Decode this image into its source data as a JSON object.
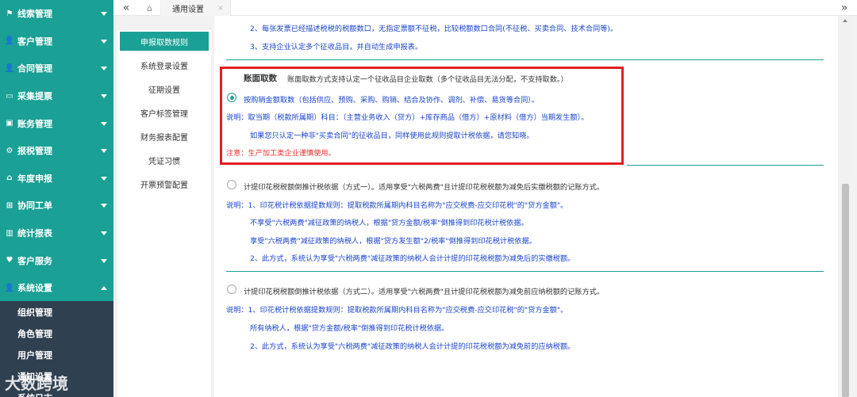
{
  "sidebar": {
    "items": [
      {
        "label": "线索管理",
        "icon": "flag-icon",
        "glyph": "⚑"
      },
      {
        "label": "客户管理",
        "icon": "user-icon",
        "glyph": "👤"
      },
      {
        "label": "合同管理",
        "icon": "user-icon",
        "glyph": "👤"
      },
      {
        "label": "采集提票",
        "icon": "inbox-icon",
        "glyph": "▭"
      },
      {
        "label": "账务管理",
        "icon": "monitor-icon",
        "glyph": "▣"
      },
      {
        "label": "报税管理",
        "icon": "gears-icon",
        "glyph": "⚙"
      },
      {
        "label": "年度申报",
        "icon": "home-icon",
        "glyph": "⌂"
      },
      {
        "label": "协同工单",
        "icon": "sitemap-icon",
        "glyph": "⊞"
      },
      {
        "label": "统计报表",
        "icon": "chart-icon",
        "glyph": "▥"
      },
      {
        "label": "客户服务",
        "icon": "heart-icon",
        "glyph": "♥"
      },
      {
        "label": "系统设置",
        "icon": "user-icon",
        "glyph": "👤"
      }
    ],
    "submenu": [
      "组织管理",
      "角色管理",
      "用户管理",
      "通知设置",
      "系统日志"
    ]
  },
  "tabbar": {
    "collapse_glyph": "«",
    "home_glyph": "⌂",
    "active_tab": "通用设置",
    "close_glyph": "×",
    "expand_glyph": "»"
  },
  "secondary_menu": [
    "申报取数规则",
    "系统登录设置",
    "征期设置",
    "客户标签管理",
    "财务报表配置",
    "凭证习惯",
    "开票预警配置"
  ],
  "content": {
    "top_line1": "2、每张发票已经描述税税的税额数口，无指定票额不征税，比较税额数口合同(不征税、买卖合同、技术合同等)。",
    "top_line2": "3、支持企业认定多个征收品目，并自动生成申报表。",
    "box_title": "账面取数",
    "box_subtitle": "账面取数方式支持认定一个征收品目企业取数（多个征收品目无法分配，不支持取数。）",
    "box_option": "按购销金额取数（包括供应、预购、采购、购销、结合及协作、调剂、补偿、易货等合同）。",
    "box_desc1": "说明：取当期（税款所属期）科目：（主营业务收入（贷方）+库存商品（借方）+原材料（借方）当期发生额）。",
    "box_desc2": "如果您只认定一种非\"买卖合同\"的征收品目，同样使用此规则提取计税依据，请您知晓。",
    "box_note": "注意：生产加工类企业谨慎使用。",
    "m1_option": "计提印花税税额倒推计税依据（方式一）。适用享受\"六税两费\"且计提印花税税额为减免后实缴税额的记账方式。",
    "m1_desc1": "说明：1、印花税计税依据提数规则：提取税款所属期内科目名称为\"应交税费-应交印花税\"的\"贷方金额\"。",
    "m1_desc2": "不享受\"六税两费\"减征政策的纳税人，根据\"贷方金额/税率\"倒推得到印花税计税依据。",
    "m1_desc3": "享受\"六税两费\"减征政策的纳税人，根据\"贷方发生额\"2/税率\"倒推得到印花税计税依据。",
    "m1_desc4": "2、此方式，系统认为享受\"六税两费\"减征政策的纳税人会计计提的印花税税额为减免后的实缴税额。",
    "m2_option": "计提印花税税额倒推计税依据（方式二）。适用享受\"六税两费\"且计提印花税税额为减免前应纳税额的记账方式。",
    "m2_desc1": "说明：1、印花税计税依据提数规则：提取税款所属期内科目名称为\"应交税费-应交印花税\"的\"贷方金额\"。",
    "m2_desc2": "所有纳税人，根据\"贷方金额/税率\"倒推得到印花税计税依据。",
    "m2_desc3": "2、此方式，系统认为享受\"六税两费\"减征政策的纳税人会计计提的印花税税额为减免前的应纳税额。"
  },
  "watermark": "大数跨境",
  "colors": {
    "accent": "#1aa094",
    "submenu_bg": "#2f4050",
    "link_blue": "#1a44cc",
    "warning_red": "#e4322b",
    "highlight_box": "#e02020"
  }
}
